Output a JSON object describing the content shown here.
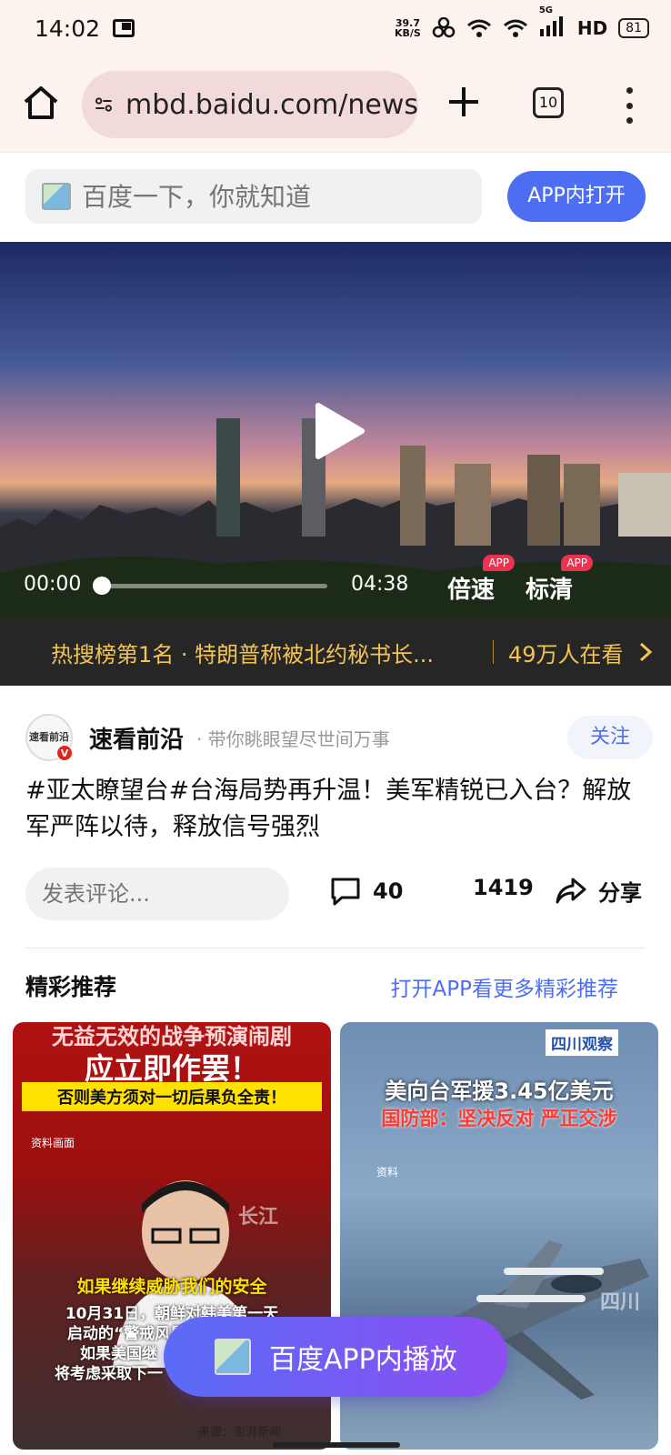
{
  "status_bar": {
    "time": "14:02",
    "net_speed_value": "39.7",
    "net_speed_unit": "KB/S",
    "signal_label": "5G",
    "hd_label": "HD",
    "battery": "81"
  },
  "browser": {
    "url": "mbd.baidu.com/news",
    "tab_count": "10"
  },
  "search": {
    "placeholder": "百度一下，你就知道",
    "open_in_app": "APP内打开"
  },
  "video": {
    "current_time": "00:00",
    "duration": "04:38",
    "progress": 0,
    "speed_label": "倍速",
    "quality_label": "标清",
    "app_badge": "APP"
  },
  "hot_bar": {
    "text": "热搜榜第1名 · 特朗普称被北约秘书长...",
    "viewers": "49万人在看"
  },
  "author": {
    "avatar_text": "速看前沿",
    "name": "速看前沿",
    "desc": "· 带你眺眼望尽世间万事",
    "follow": "关注"
  },
  "headline": "#亚太瞭望台#台海局势再升温！美军精锐已入台？解放军严阵以待，释放信号强烈",
  "actions": {
    "comment_placeholder": "发表评论...",
    "comment_count": "40",
    "like_count": "1419",
    "share_label": "分享"
  },
  "recommend": {
    "title": "精彩推荐",
    "link": "打开APP看更多精彩推荐",
    "cards": [
      {
        "line_top": "无益无效的战争预演闹剧",
        "line_big": "应立即作罢！",
        "line_box": "否则美方须对一切后果负全责！",
        "note": "资料画面",
        "sub1": "如果继续威胁我们的安全",
        "sub2": "10月31日，朝鲜对韩美第一天",
        "sub3": "启动的“警戒风暴”",
        "sub4": "如果美国继",
        "sub5": "将考虑采取下一",
        "source": "来源：澎湃新闻",
        "watermark": "长江"
      },
      {
        "brand": "四川观察",
        "line1": "美向台军援3.45亿美元",
        "line2": "国防部：坚决反对 严正交涉",
        "note": "资料",
        "watermark": "四川"
      }
    ]
  },
  "float_button": "百度APP内播放"
}
